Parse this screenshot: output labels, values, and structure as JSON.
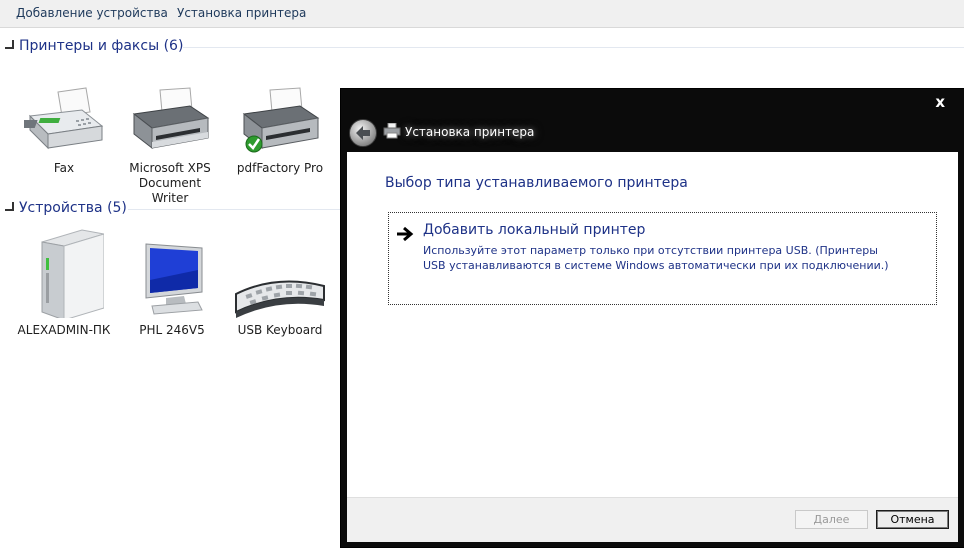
{
  "toolbar": {
    "add_device": "Добавление устройства",
    "add_printer": "Установка принтера"
  },
  "groups": {
    "printers": {
      "label": "Принтеры и факсы (6)",
      "items": [
        {
          "label": "Fax",
          "icon": "fax-icon"
        },
        {
          "label": "Microsoft XPS\nDocument Writer",
          "icon": "printer-icon"
        },
        {
          "label": "pdfFactory Pro",
          "icon": "default-printer-icon"
        }
      ]
    },
    "devices": {
      "label": "Устройства (5)",
      "items": [
        {
          "label": "ALEXADMIN-ПК",
          "icon": "computer-icon"
        },
        {
          "label": "PHL 246V5",
          "icon": "monitor-icon"
        },
        {
          "label": "USB Keyboard",
          "icon": "keyboard-icon"
        }
      ]
    }
  },
  "dialog": {
    "title": "Установка принтера",
    "close_glyph": "x",
    "heading": "Выбор типа устанавливаемого принтера",
    "option": {
      "title": "Добавить локальный принтер",
      "description": "Используйте этот параметр только при отсутствии принтера USB. (Принтеры USB устанавливаются в системе Windows автоматически при их подключении.)"
    },
    "buttons": {
      "next": "Далее",
      "cancel": "Отмена"
    }
  },
  "colors": {
    "link_blue": "#1e3287",
    "dialog_chrome": "#0b0b0b",
    "footer_bg": "#f0f0f0"
  }
}
